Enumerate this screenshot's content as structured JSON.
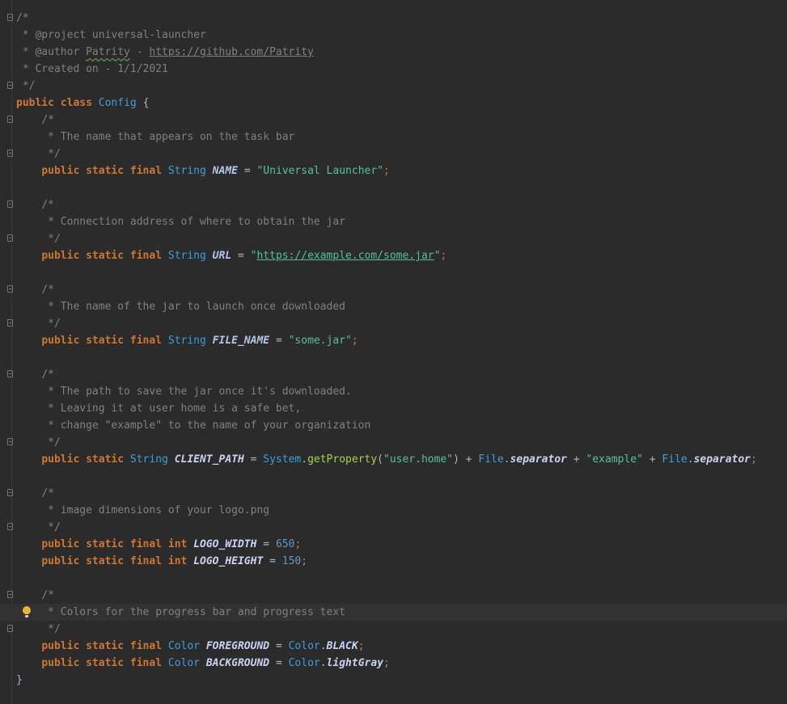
{
  "colors": {
    "background": "#2b2b2b",
    "comment": "#808080",
    "keyword": "#cc7832",
    "type": "#3d9fda",
    "string": "#54c19a",
    "number": "#6897bb",
    "method": "#a6d34a"
  },
  "code": {
    "header_open": "/*",
    "project_line": " * @project universal-launcher",
    "author_prefix": " * @author ",
    "author_name": "Patrity",
    "author_sep": " - ",
    "author_url": "https://github.com/Patrity",
    "created_line": " * Created on - 1/1/2021",
    "header_close": " */",
    "kw_public": "public",
    "kw_static": "static",
    "kw_final": "final",
    "kw_class": "class",
    "kw_int": "int",
    "class_name": "Config",
    "brace_open": "{",
    "brace_close": "}",
    "type_string": "String",
    "type_color": "Color",
    "comment_open": "/*",
    "comment_close": " */",
    "c_name": " * The name that appears on the task bar",
    "f_name": "NAME",
    "v_name": "\"Universal Launcher\"",
    "c_url": " * Connection address of where to obtain the jar",
    "f_url": "URL",
    "v_url_q": "\"",
    "v_url": "https://example.com/some.jar",
    "c_file": " * The name of the jar to launch once downloaded",
    "f_file": "FILE_NAME",
    "v_file": "\"some.jar\"",
    "c_path_1": " * The path to save the jar once it's downloaded.",
    "c_path_2": " * Leaving it at user home is a safe bet,",
    "c_path_3": " * change \"example\" to the name of your organization",
    "f_path": "CLIENT_PATH",
    "cls_system": "System",
    "m_getproperty": "getProperty",
    "v_userhome": "\"user.home\"",
    "cls_file": "File",
    "f_separator": "separator",
    "v_example": "\"example\"",
    "c_logo": " * image dimensions of your logo.png",
    "f_logo_w": "LOGO_WIDTH",
    "v_logo_w": "650",
    "f_logo_h": "LOGO_HEIGHT",
    "v_logo_h": "150",
    "c_colors": " * Colors for the progress bar and progress text",
    "f_fg": "FOREGROUND",
    "v_black": "BLACK",
    "f_bg": "BACKGROUND",
    "v_lightgray": "lightGray"
  }
}
